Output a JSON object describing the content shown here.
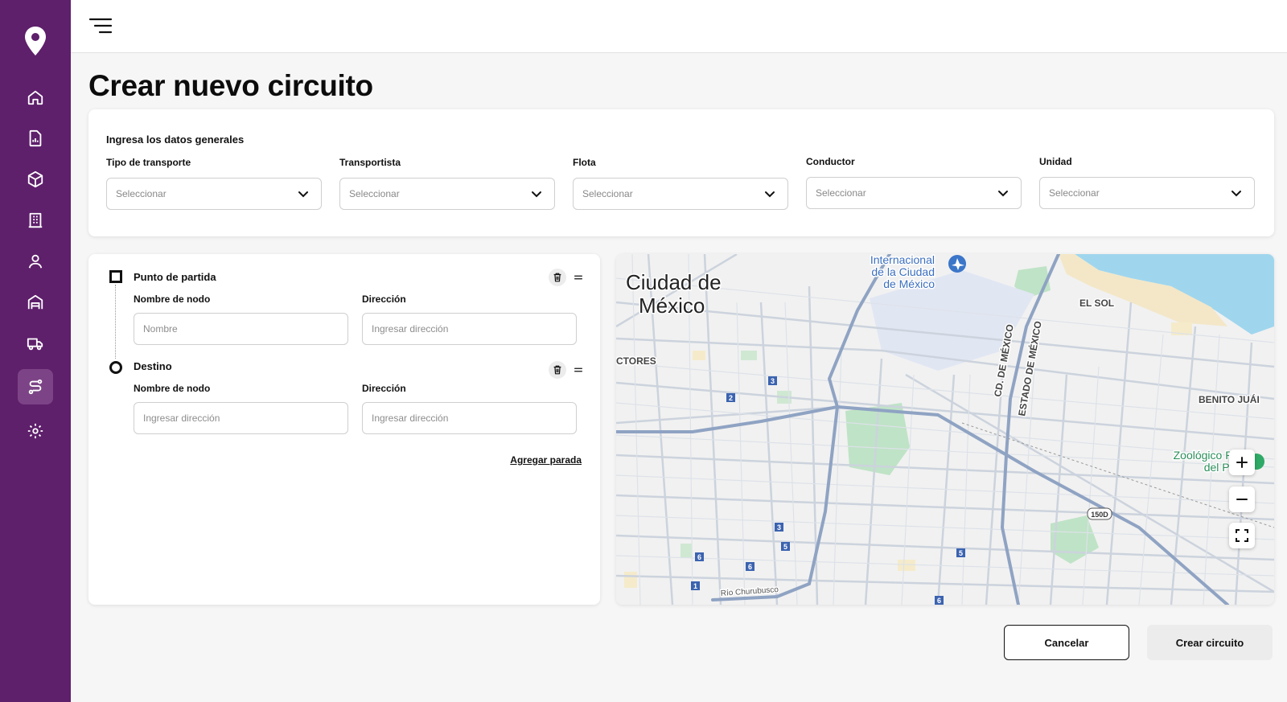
{
  "page": {
    "title": "Crear nuevo circuito"
  },
  "sidebar": {
    "items": [
      {
        "name": "home",
        "icon": "home-icon"
      },
      {
        "name": "reports",
        "icon": "report-document-icon"
      },
      {
        "name": "packages",
        "icon": "package-icon"
      },
      {
        "name": "buildings",
        "icon": "building-icon"
      },
      {
        "name": "users",
        "icon": "user-icon"
      },
      {
        "name": "warehouse",
        "icon": "warehouse-icon"
      },
      {
        "name": "fleet",
        "icon": "delivery-truck-icon"
      },
      {
        "name": "routes",
        "icon": "route-icon",
        "active": true
      },
      {
        "name": "settings",
        "icon": "gear-icon"
      }
    ]
  },
  "general": {
    "section_title": "Ingresa los datos generales",
    "fields": [
      {
        "label": "Tipo de transporte",
        "placeholder": "Seleccionar"
      },
      {
        "label": "Transportista",
        "placeholder": "Seleccionar"
      },
      {
        "label": "Flota",
        "placeholder": "Seleccionar"
      },
      {
        "label": "Conductor",
        "placeholder": "Seleccionar"
      },
      {
        "label": "Unidad",
        "placeholder": "Seleccionar"
      }
    ]
  },
  "route": {
    "stops": [
      {
        "title": "Punto de partida",
        "name_label": "Nombre de nodo",
        "name_placeholder": "Nombre",
        "address_label": "Dirección",
        "address_placeholder": "Ingresar dirección"
      },
      {
        "title": "Destino",
        "name_label": "Nombre de nodo",
        "name_placeholder": "Ingresar dirección",
        "address_label": "Dirección",
        "address_placeholder": "Ingresar dirección"
      }
    ],
    "add_stop_label": "Agregar parada"
  },
  "map": {
    "labels": {
      "city_line1": "Ciudad de",
      "city_line2": "México",
      "airport_line1": "Internacional",
      "airport_line2": "de la Ciudad",
      "airport_line3": "de México",
      "el_sol": "EL SOL",
      "ctores": "CTORES",
      "cd_mexico": "CD. DE MÉXICO",
      "estado_mexico": "ESTADO DE MÉXICO",
      "benito": "BENITO JUÁI",
      "zoo_line1": "Zoológico Parc",
      "zoo_line2": "del Pueb",
      "river": "Río Churubusco",
      "highway": "150D"
    },
    "metro_badges": [
      "3",
      "2",
      "3",
      "5",
      "6",
      "6",
      "1",
      "5",
      "6"
    ],
    "colors": {
      "road": "#ccd3dd",
      "highway": "#8fa3c3",
      "park": "#bfe3c6",
      "water": "#9fd6ee",
      "base": "#f1f1f1"
    }
  },
  "actions": {
    "cancel_label": "Cancelar",
    "create_label": "Crear circuito"
  },
  "colors": {
    "sidebar": "#5e1f6b",
    "sidebar_active": "#7c4486"
  }
}
